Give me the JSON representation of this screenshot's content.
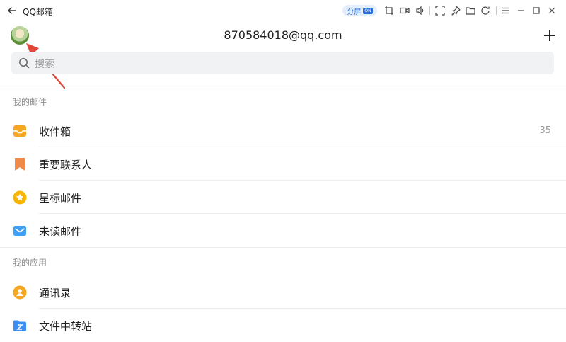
{
  "window": {
    "title": "QQ邮箱",
    "split_label": "分屏",
    "split_badge": "ON"
  },
  "header": {
    "account": "870584018@qq.com"
  },
  "search": {
    "placeholder": "搜索"
  },
  "sections": {
    "mail": "我的邮件",
    "apps": "我的应用"
  },
  "mail_items": [
    {
      "label": "收件箱",
      "count": "35",
      "icon": "inbox-icon"
    },
    {
      "label": "重要联系人",
      "icon": "bookmark-icon"
    },
    {
      "label": "星标邮件",
      "icon": "star-icon"
    },
    {
      "label": "未读邮件",
      "icon": "envelope-icon"
    }
  ],
  "app_items": [
    {
      "label": "通讯录",
      "icon": "contacts-icon"
    },
    {
      "label": "文件中转站",
      "icon": "folder-icon"
    }
  ],
  "colors": {
    "accent": "#2d6fd9",
    "inbox": "#f5a623",
    "bookmark": "#f08a4b",
    "star": "#f7b500",
    "envelope": "#3d9ff5",
    "contacts": "#f5a623",
    "folder": "#3d8ef0",
    "arrow": "#e0453a"
  }
}
